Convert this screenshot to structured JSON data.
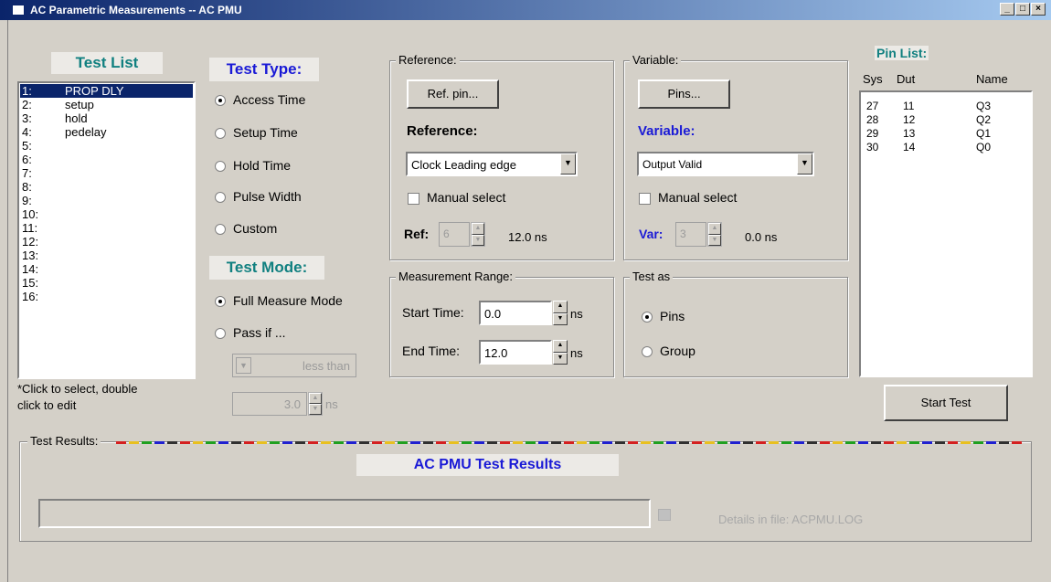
{
  "window": {
    "title": "AC Parametric Measurements  --  AC PMU",
    "minimize": "_",
    "maximize": "□",
    "close": "×"
  },
  "test_list": {
    "heading": "Test List",
    "items": [
      {
        "num": "1:",
        "name": "PROP DLY",
        "selected": true
      },
      {
        "num": "2:",
        "name": "setup"
      },
      {
        "num": "3:",
        "name": "hold"
      },
      {
        "num": "4:",
        "name": "pedelay"
      },
      {
        "num": "5:",
        "name": ""
      },
      {
        "num": "6:",
        "name": ""
      },
      {
        "num": "7:",
        "name": ""
      },
      {
        "num": "8:",
        "name": ""
      },
      {
        "num": "9:",
        "name": ""
      },
      {
        "num": "10:",
        "name": ""
      },
      {
        "num": "11:",
        "name": ""
      },
      {
        "num": "12:",
        "name": ""
      },
      {
        "num": "13:",
        "name": ""
      },
      {
        "num": "14:",
        "name": ""
      },
      {
        "num": "15:",
        "name": ""
      },
      {
        "num": "16:",
        "name": ""
      }
    ],
    "hint_line1": "*Click to select, double",
    "hint_line2": "click to edit"
  },
  "test_type": {
    "heading": "Test Type:",
    "options": [
      "Access Time",
      "Setup Time",
      "Hold Time",
      "Pulse Width",
      "Custom"
    ],
    "selected": "Access Time"
  },
  "test_mode": {
    "heading": "Test Mode:",
    "full": "Full Measure Mode",
    "pass_if": "Pass if ...",
    "comparator": "less than",
    "threshold": "3.0",
    "unit": "ns"
  },
  "reference": {
    "group_label": "Reference:",
    "button": "Ref. pin...",
    "heading": "Reference:",
    "combo_value": "Clock Leading edge",
    "manual_select": "Manual select",
    "ref_label": "Ref:",
    "ref_value": "6",
    "time": "12.0 ns"
  },
  "variable": {
    "group_label": "Variable:",
    "button": "Pins...",
    "heading": "Variable:",
    "combo_value": "Output Valid",
    "manual_select": "Manual select",
    "var_label": "Var:",
    "var_value": "3",
    "time": "0.0 ns"
  },
  "measurement_range": {
    "group_label": "Measurement Range:",
    "start_label": "Start Time:",
    "start_value": "0.0",
    "end_label": "End Time:",
    "end_value": "12.0",
    "unit": "ns"
  },
  "test_as": {
    "group_label": "Test as",
    "pins": "Pins",
    "group": "Group",
    "selected": "Pins"
  },
  "pin_list": {
    "heading": "Pin List:",
    "columns": [
      "Sys",
      "Dut",
      "Name"
    ],
    "rows": [
      {
        "sys": "27",
        "dut": "11",
        "name": "Q3"
      },
      {
        "sys": "28",
        "dut": "12",
        "name": "Q2"
      },
      {
        "sys": "29",
        "dut": "13",
        "name": "Q1"
      },
      {
        "sys": "30",
        "dut": "14",
        "name": "Q0"
      }
    ],
    "start_button": "Start Test"
  },
  "results": {
    "group_label": "Test Results:",
    "heading": "AC PMU  Test Results",
    "details": "Details in file:  ACPMU.LOG"
  },
  "colors": {
    "teal_heading": "#118080",
    "blue_heading": "#1a1ad6",
    "selection": "#0a246a",
    "dash_colors": [
      "#d42020",
      "#e8c020",
      "#20a020",
      "#2020d0",
      "#303030"
    ]
  }
}
